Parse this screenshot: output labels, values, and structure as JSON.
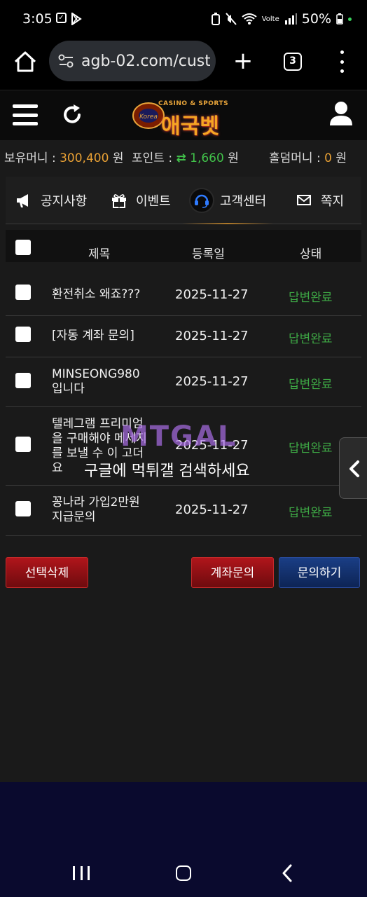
{
  "status_bar": {
    "time": "3:05",
    "battery": "50%",
    "network": "Volte"
  },
  "browser": {
    "url": "agb-02.com/cust",
    "tab_count": "3"
  },
  "site": {
    "logo_sub": "CASINO & SPORTS",
    "logo_main": "애국벳",
    "logo_badge_text": "Korea"
  },
  "balance": {
    "money_label": "보유머니 :",
    "money_value": "300,400",
    "money_unit": "원",
    "point_label": "포인트 :",
    "point_value": "1,660",
    "point_unit": "원",
    "hold_label": "홀덤머니 :",
    "hold_value": "0",
    "hold_unit": "원"
  },
  "tabs": [
    {
      "label": "공지사항",
      "icon": "megaphone-icon"
    },
    {
      "label": "이벤트",
      "icon": "gift-icon"
    },
    {
      "label": "고객센터",
      "icon": "headset-icon"
    },
    {
      "label": "쪽지",
      "icon": "envelope-icon"
    }
  ],
  "table": {
    "headers": {
      "title": "제목",
      "date": "등록일",
      "status": "상태"
    },
    "rows": [
      {
        "title": "환전취소 왜죠???",
        "date": "2025-11-27",
        "status": "답변완료"
      },
      {
        "title": "[자동 계좌 문의]",
        "date": "2025-11-27",
        "status": "답변완료"
      },
      {
        "title": "MINSEONG980입니다",
        "date": "2025-11-27",
        "status": "답변완료"
      },
      {
        "title": "텔레그램 프리미엄을 구매해야 메세지를 보낼 수 이 고더요",
        "date": "2025-11-27",
        "status": "답변완료"
      },
      {
        "title": "꽁나라 가입2만원 지급문의",
        "date": "2025-11-27",
        "status": "답변완료"
      }
    ]
  },
  "buttons": {
    "delete_selected": "선택삭제",
    "account_inquiry": "계좌문의",
    "inquire": "문의하기"
  },
  "watermark": {
    "logo": "MTGAL",
    "text": "구글에 먹튀갤 검색하세요"
  },
  "colors": {
    "accent_orange": "#e8a034",
    "status_green": "#3ea845",
    "button_red": "#b0151b",
    "button_blue": "#1a3e85"
  }
}
